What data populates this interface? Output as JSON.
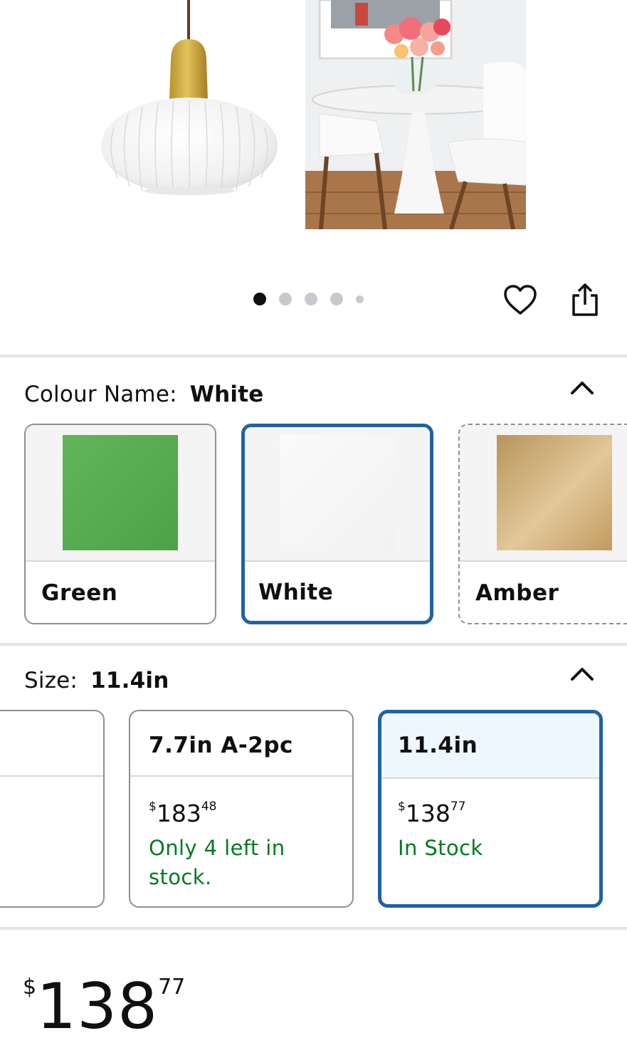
{
  "carousel": {
    "total": 5,
    "active_index": 0
  },
  "actions": {
    "wishlist_icon": "heart-icon",
    "share_icon": "share-icon"
  },
  "colour": {
    "label": "Colour Name:",
    "selected": "White",
    "options": [
      {
        "name": "Green",
        "color": "#5ab053"
      },
      {
        "name": "White",
        "color": "#f7f7f8"
      },
      {
        "name": "Amber",
        "color": "#c9a468"
      }
    ]
  },
  "size": {
    "label": "Size:",
    "selected": "11.4in",
    "options": [
      {
        "name": "7.7in A-2pc",
        "price_symbol": "$",
        "price_whole": "183",
        "price_fraction": "48",
        "stock": "Only 4 left in stock."
      },
      {
        "name": "11.4in",
        "price_symbol": "$",
        "price_whole": "138",
        "price_fraction": "77",
        "stock": "In Stock"
      }
    ]
  },
  "price": {
    "symbol": "$",
    "whole": "138",
    "fraction": "77"
  },
  "colors": {
    "accent": "#2162a1",
    "in_stock": "#007b1f",
    "divider": "#e3e6e6"
  }
}
